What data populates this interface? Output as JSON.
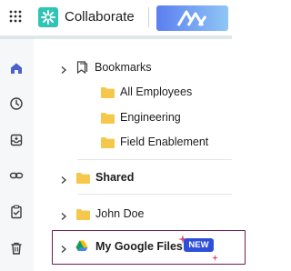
{
  "app": {
    "title": "Collaborate"
  },
  "colors": {
    "accent": "#2ec4b6",
    "folder": "#f5c84c",
    "badge": "#2f4fd6",
    "highlight_border": "#6e1f4b"
  },
  "rail": {
    "icons": [
      "home-icon",
      "clock-icon",
      "inbox-icon",
      "link-icon",
      "clipboard-check-icon",
      "trash-icon"
    ]
  },
  "tree": {
    "bookmarks": {
      "label": "Bookmarks",
      "children": [
        "All Employees",
        "Engineering",
        "Field Enablement"
      ]
    },
    "shared": {
      "label": "Shared"
    },
    "user": {
      "label": "John Doe"
    },
    "google": {
      "label": "My Google Files",
      "badge": "NEW"
    }
  }
}
